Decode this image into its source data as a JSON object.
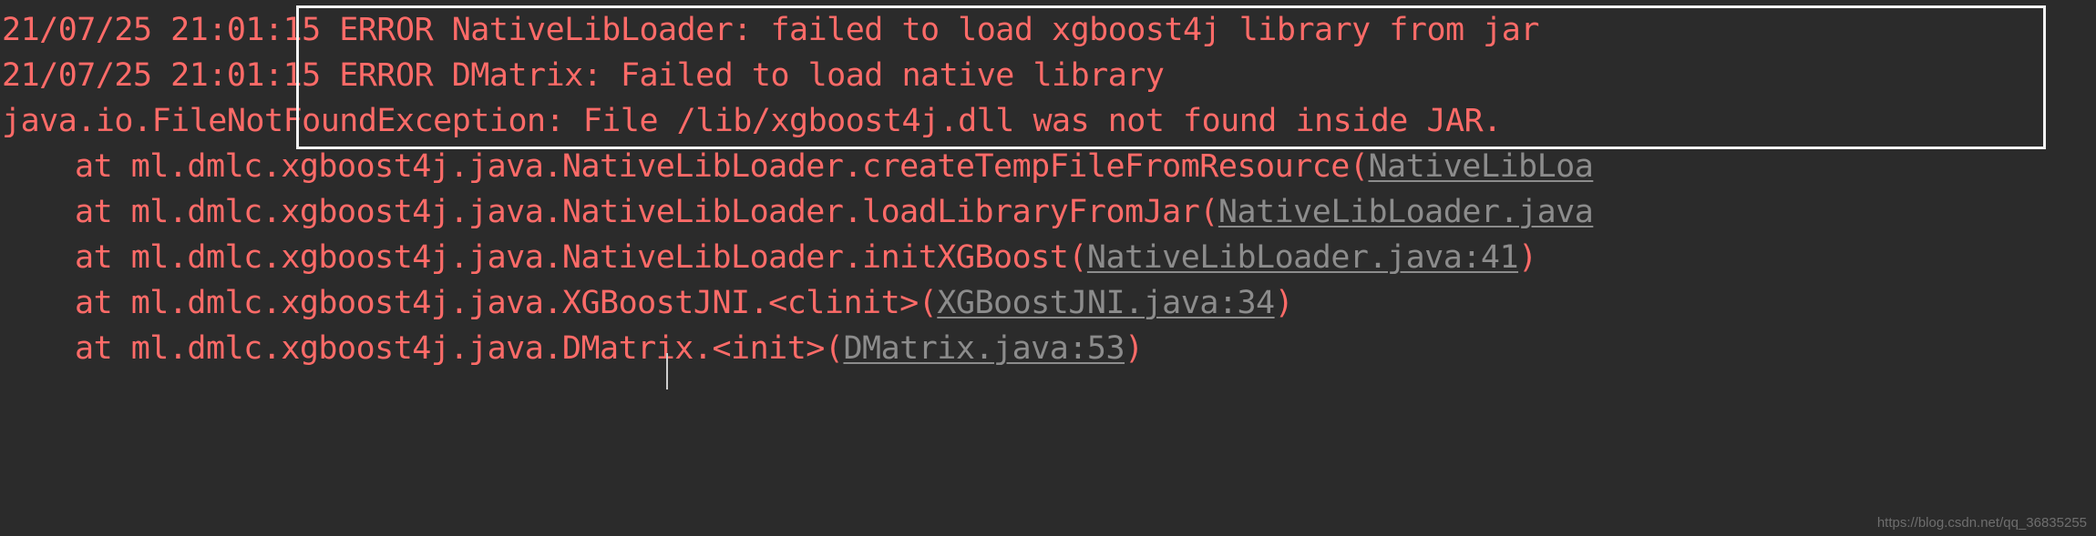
{
  "console": {
    "background_color": "#2b2b2b",
    "text_color": "#ff6b68",
    "link_color": "#8c8c8c",
    "highlight_border_color": "#f2f2f2",
    "lines": [
      {
        "indent": 0,
        "segments": [
          {
            "kind": "text",
            "text": "21/07/25 21:01:15 ERROR NativeLibLoader: failed to load xgboost4j library from jar"
          }
        ]
      },
      {
        "indent": 0,
        "segments": [
          {
            "kind": "text",
            "text": "21/07/25 21:01:15 ERROR DMatrix: Failed to load native library"
          }
        ]
      },
      {
        "indent": 0,
        "segments": [
          {
            "kind": "text",
            "text": "java.io.FileNotFoundException: File /lib/xgboost4j.dll was not found inside JAR."
          }
        ]
      },
      {
        "indent": 1,
        "segments": [
          {
            "kind": "text",
            "text": "at ml.dmlc.xgboost4j.java.NativeLibLoader.createTempFileFromResource("
          },
          {
            "kind": "link",
            "text": "NativeLibLoa"
          }
        ]
      },
      {
        "indent": 1,
        "segments": [
          {
            "kind": "text",
            "text": "at ml.dmlc.xgboost4j.java.NativeLibLoader.loadLibraryFromJar("
          },
          {
            "kind": "link",
            "text": "NativeLibLoader.java"
          }
        ]
      },
      {
        "indent": 1,
        "segments": [
          {
            "kind": "text",
            "text": "at ml.dmlc.xgboost4j.java.NativeLibLoader.initXGBoost("
          },
          {
            "kind": "link",
            "text": "NativeLibLoader.java:41"
          },
          {
            "kind": "text",
            "text": ")"
          }
        ]
      },
      {
        "indent": 1,
        "segments": [
          {
            "kind": "text",
            "text": "at ml.dmlc.xgboost4j.java.XGBoostJNI.<clinit>("
          },
          {
            "kind": "link",
            "text": "XGBoostJNI.java:34"
          },
          {
            "kind": "text",
            "text": ")"
          }
        ]
      },
      {
        "indent": 1,
        "segments": [
          {
            "kind": "text",
            "text": "at ml.dmlc.xgboost4j.java.DMatrix.<init>("
          },
          {
            "kind": "link",
            "text": "DMatrix.java:53"
          },
          {
            "kind": "text",
            "text": ")"
          }
        ]
      }
    ]
  },
  "watermark": {
    "text": "https://blog.csdn.net/qq_36835255"
  }
}
